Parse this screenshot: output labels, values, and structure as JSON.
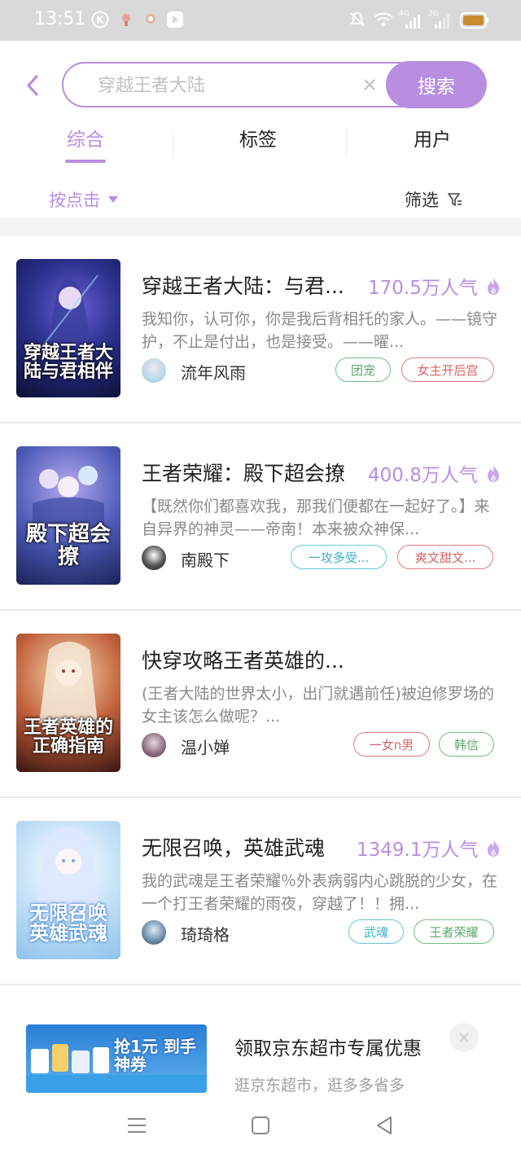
{
  "status_bar": {
    "time": "13:51",
    "network_a": "4G",
    "network_b": "2G",
    "battery_color": "#c88a2a"
  },
  "search": {
    "placeholder": "穿越王者大陆",
    "button_label": "搜索"
  },
  "tabs": [
    {
      "label": "综合",
      "active": true
    },
    {
      "label": "标签",
      "active": false
    },
    {
      "label": "用户",
      "active": false
    }
  ],
  "filter_row": {
    "sort_label": "按点击",
    "filter_label": "筛选"
  },
  "books": [
    {
      "title": "穿越王者大陆：与君...",
      "popularity": "170.5万人气",
      "description": "我知你，认可你，你是我后背相托的家人。——镜守护，不止是付出，也是接受。——曜...",
      "author": "流年风雨",
      "cover_text": "穿越王者大陆与君相伴",
      "tags": [
        {
          "label": "团宠",
          "style": "green"
        },
        {
          "label": "女主开后宫",
          "style": "red"
        }
      ]
    },
    {
      "title": "王者荣耀：殿下超会撩",
      "popularity": "400.8万人气",
      "description": "【既然你们都喜欢我，那我们便都在一起好了。】来自异界的神灵——帝南！本来被众神保...",
      "author": "南殿下",
      "cover_text": "殿下超会撩",
      "tags": [
        {
          "label": "一攻多受...",
          "style": "cyan"
        },
        {
          "label": "爽文甜文...",
          "style": "red"
        }
      ]
    },
    {
      "title": "快穿攻略王者英雄的...",
      "popularity": "",
      "description": "(王者大陆的世界太小，出门就遇前任)被迫修罗场的女主该怎么做呢？...",
      "author": "温小婵",
      "cover_text": "王者英雄的正确指南",
      "tags": [
        {
          "label": "一女n男",
          "style": "red"
        },
        {
          "label": "韩信",
          "style": "green"
        }
      ]
    },
    {
      "title": "无限召唤，英雄武魂",
      "popularity": "1349.1万人气",
      "description": "我的武魂是王者荣耀％外表病弱内心跳脱的少女，在一个打王者荣耀的雨夜，穿越了！！拥...",
      "author": "琦琦格",
      "cover_text": "无限召唤英雄武魂",
      "tags": [
        {
          "label": "武魂",
          "style": "cyan"
        },
        {
          "label": "王者荣耀",
          "style": "green"
        }
      ]
    }
  ],
  "ad": {
    "title": "领取京东超市专属优惠",
    "subtitle": "逛京东超市，逛多多省多",
    "image_text": "抢1元 到手神券"
  },
  "colors": {
    "accent": "#b98ee0",
    "tag_green": "#6fbf7d",
    "tag_red": "#e07a7a",
    "tag_cyan": "#64c7dc"
  }
}
